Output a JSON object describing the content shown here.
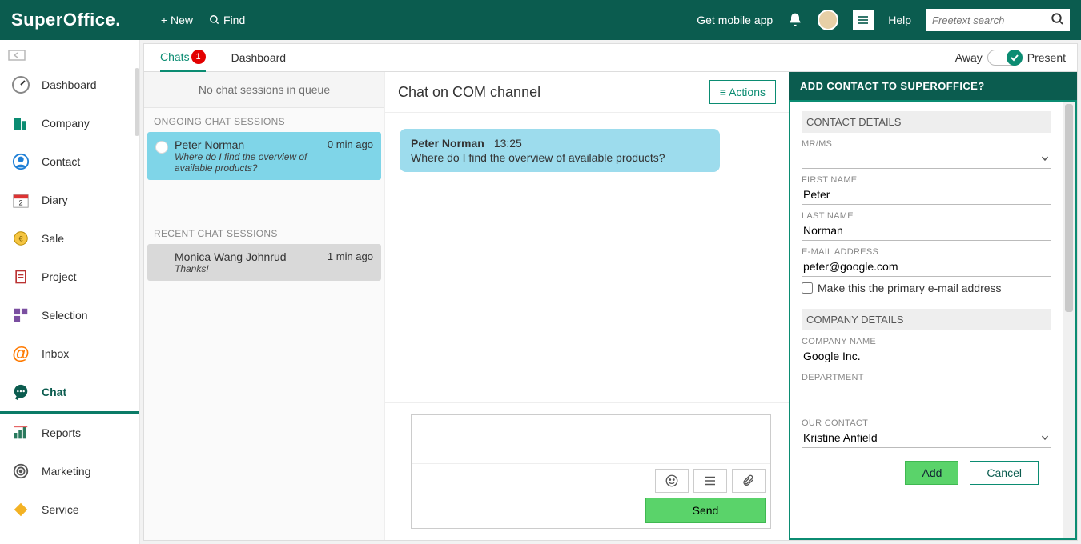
{
  "topbar": {
    "logo": "SuperOffice.",
    "new": "New",
    "find": "Find",
    "mobile": "Get mobile app",
    "help": "Help",
    "search_placeholder": "Freetext search"
  },
  "nav": {
    "items": [
      {
        "label": "Dashboard"
      },
      {
        "label": "Company"
      },
      {
        "label": "Contact"
      },
      {
        "label": "Diary"
      },
      {
        "label": "Sale"
      },
      {
        "label": "Project"
      },
      {
        "label": "Selection"
      },
      {
        "label": "Inbox"
      },
      {
        "label": "Chat"
      },
      {
        "label": "Reports"
      },
      {
        "label": "Marketing"
      },
      {
        "label": "Service"
      }
    ]
  },
  "tabs": {
    "chats": "Chats",
    "chats_badge": "1",
    "dashboard": "Dashboard"
  },
  "presence": {
    "away": "Away",
    "present": "Present"
  },
  "chatlist": {
    "queue_hint": "No chat sessions in queue",
    "ongoing_label": "ONGOING CHAT SESSIONS",
    "ongoing": {
      "name": "Peter Norman",
      "time": "0 min ago",
      "preview": "Where do I find the overview of available products?"
    },
    "recent_label": "RECENT CHAT SESSIONS",
    "recent": {
      "name": "Monica Wang Johnrud",
      "time": "1 min ago",
      "preview": "Thanks!"
    }
  },
  "chat": {
    "title": "Chat on COM channel",
    "actions": "Actions",
    "msg": {
      "name": "Peter Norman",
      "time": "13:25",
      "body": "Where do I find the overview of available products?"
    },
    "send": "Send"
  },
  "side": {
    "heading": "ADD CONTACT TO SUPEROFFICE?",
    "contact_section": "CONTACT DETAILS",
    "mrms_label": "MR/MS",
    "mrms_value": "",
    "first_label": "FIRST NAME",
    "first_value": "Peter",
    "last_label": "LAST NAME",
    "last_value": "Norman",
    "email_label": "E-MAIL ADDRESS",
    "email_value": "peter@google.com",
    "primary_label": "Make this the primary e-mail address",
    "company_section": "COMPANY DETAILS",
    "company_label": "COMPANY NAME",
    "company_value": "Google Inc.",
    "dept_label": "DEPARTMENT",
    "dept_value": "",
    "our_contact_label": "OUR CONTACT",
    "our_contact_value": "Kristine Anfield",
    "add": "Add",
    "cancel": "Cancel"
  }
}
